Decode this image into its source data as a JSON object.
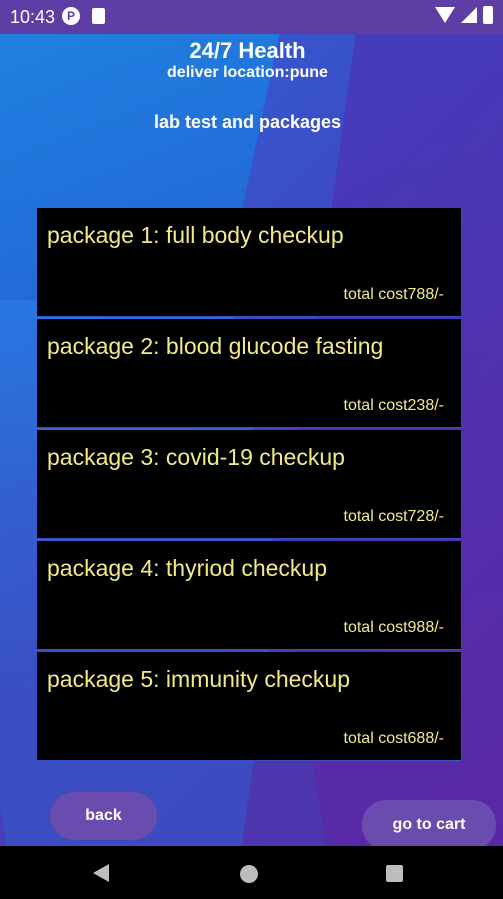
{
  "status_bar": {
    "time": "10:43"
  },
  "header": {
    "app_title": "24/7 Health",
    "deliver_location": "deliver location:pune",
    "subtitle": "lab test and packages"
  },
  "packages": [
    {
      "title": "package 1: full body checkup",
      "cost": "total cost788/-"
    },
    {
      "title": "package 2: blood glucode fasting",
      "cost": "total cost238/-"
    },
    {
      "title": "package 3: covid-19 checkup",
      "cost": "total cost728/-"
    },
    {
      "title": "package 4: thyriod checkup",
      "cost": "total cost988/-"
    },
    {
      "title": "package 5: immunity checkup",
      "cost": "total cost688/-"
    }
  ],
  "actions": {
    "back_label": "back",
    "cart_label": "go to cart"
  },
  "icons": {
    "status_left": [
      "data-saver-icon",
      "sim-card-icon"
    ],
    "status_right": [
      "wifi-icon",
      "signal-icon",
      "battery-icon"
    ],
    "navigation": [
      "nav-back-icon",
      "nav-home-icon",
      "nav-recents-icon"
    ]
  },
  "colors": {
    "status_bar": "#5e3ea5",
    "card_background": "#000000",
    "card_text": "#f3ea86",
    "button": "#6a4cae"
  }
}
